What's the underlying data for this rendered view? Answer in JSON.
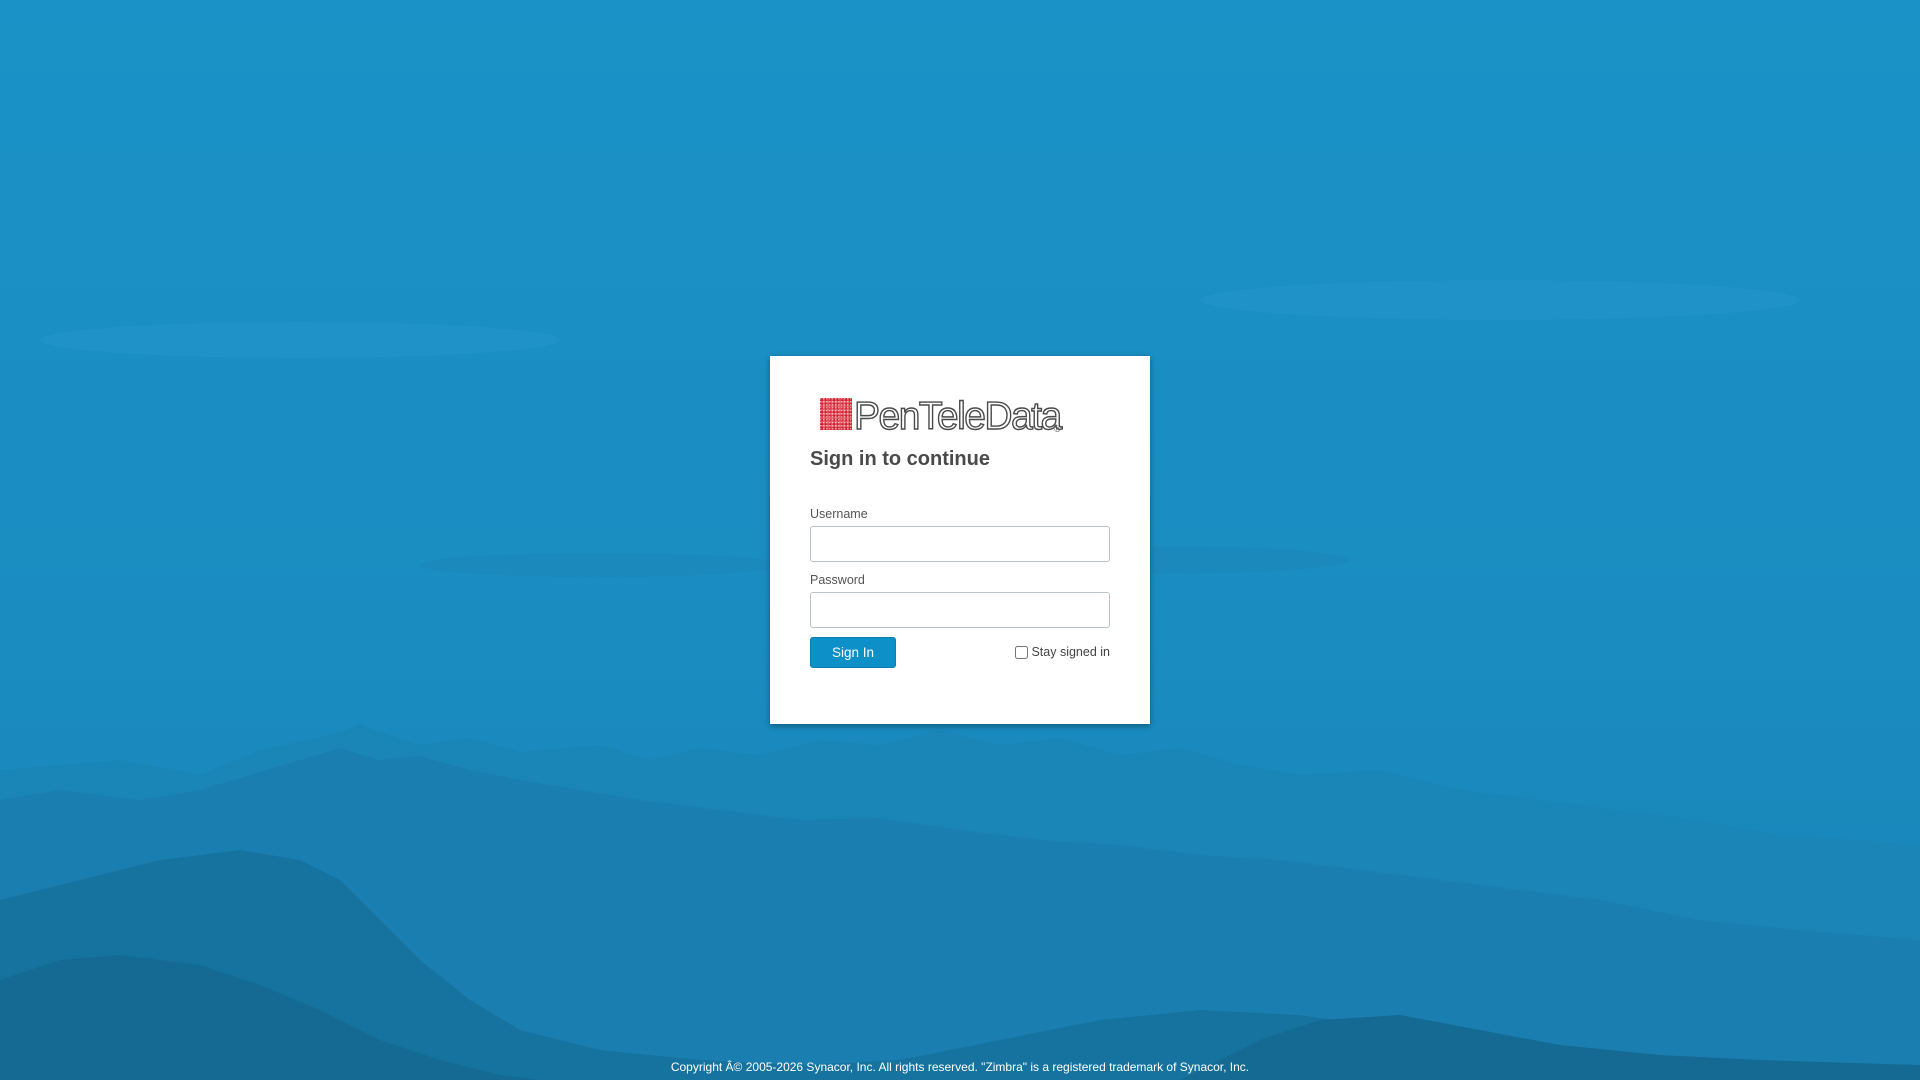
{
  "page": {
    "background_color": "#1a8cbf",
    "card_color": "#ffffff",
    "accent_color": "#0d8fc7"
  },
  "login": {
    "logo": {
      "text": "PenTeleData",
      "mark": "®",
      "logo_red": "#d6202f"
    },
    "heading": "Sign in to continue",
    "username": {
      "label": "Username",
      "value": "",
      "placeholder": ""
    },
    "password": {
      "label": "Password",
      "value": "",
      "placeholder": ""
    },
    "sign_in_label": "Sign In",
    "stay_signed_in": {
      "label": "Stay signed in",
      "checked": false
    }
  },
  "footer": {
    "text": "Copyright Â© 2005-2026 Synacor, Inc. All rights reserved. \"Zimbra\" is a registered trademark of Synacor, Inc."
  }
}
